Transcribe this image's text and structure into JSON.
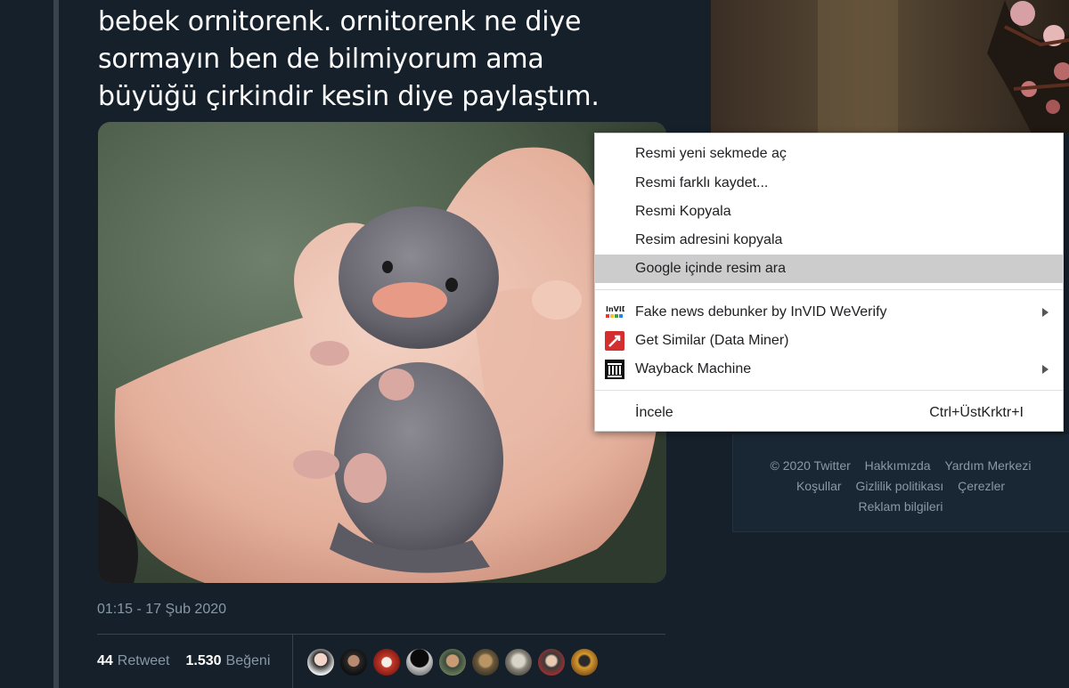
{
  "tweet": {
    "text_lines": [
      "bebek ornitorenk. ornitorenk ne diye",
      "sormayın ben de bilmiyorum ama",
      "büyüğü çirkindir kesin diye paylaştım."
    ],
    "timestamp": "01:15 - 17 Şub 2020",
    "retweet_count": "44",
    "retweet_label": "Retweet",
    "like_count": "1.530",
    "like_label": "Beğeni"
  },
  "context_menu": {
    "items": [
      {
        "label": "Resmi yeni sekmede aç"
      },
      {
        "label": "Resmi farklı kaydet..."
      },
      {
        "label": "Resmi Kopyala"
      },
      {
        "label": "Resim adresini kopyala"
      },
      {
        "label": "Google içinde resim ara",
        "highlighted": true
      },
      {
        "label": "Fake news debunker by InVID  WeVerify",
        "icon": "invid-icon",
        "icon_text": "InVID",
        "submenu": true
      },
      {
        "label": "Get Similar (Data Miner)",
        "icon": "data-miner-icon"
      },
      {
        "label": "Wayback Machine",
        "icon": "wayback-icon",
        "submenu": true
      },
      {
        "label": "İncele",
        "shortcut": "Ctrl+ÜstKrktr+I"
      }
    ]
  },
  "footer": {
    "links": [
      "© 2020 Twitter",
      "Hakkımızda",
      "Yardım Merkezi",
      "Koşullar",
      "Gizlilik politikası",
      "Çerezler",
      "Reklam bilgileri"
    ]
  },
  "colors": {
    "background": "#15202b",
    "text_primary": "#ffffff",
    "text_secondary": "#8899a6",
    "menu_highlight": "#cccccc"
  }
}
